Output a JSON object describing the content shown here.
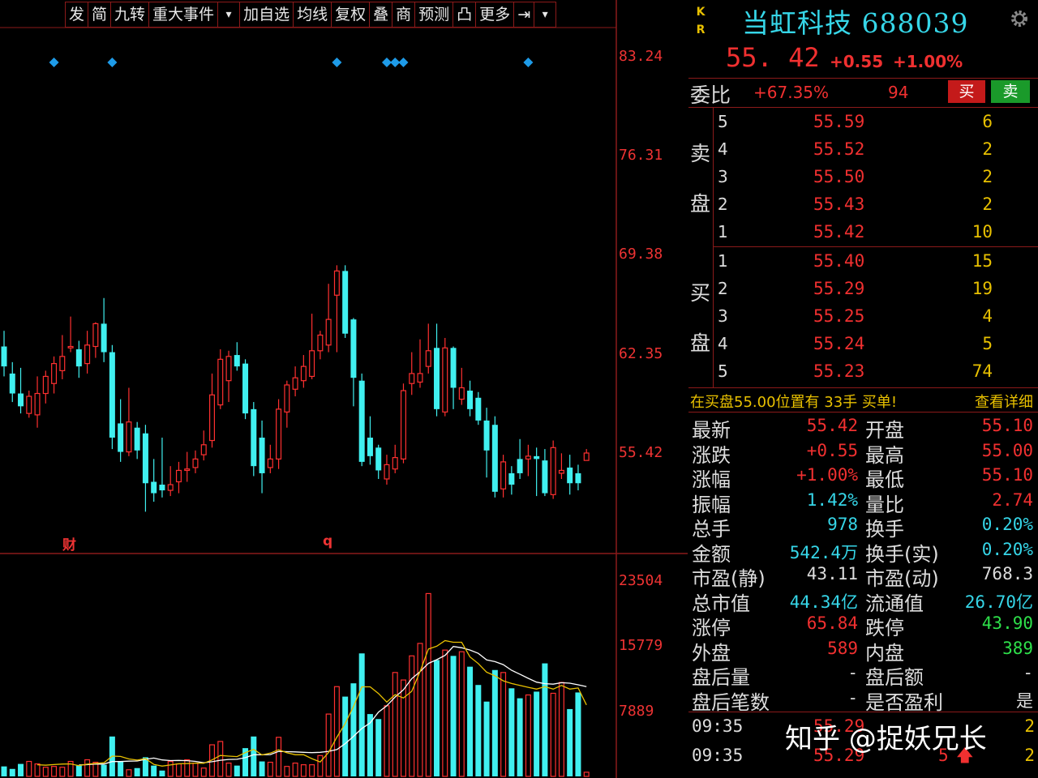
{
  "toolbar": {
    "items": [
      "发",
      "简",
      "九转",
      "重大事件",
      "▾",
      "加自选",
      "均线",
      "复权",
      "叠",
      "商",
      "预测",
      "凸",
      "更多",
      "⇥",
      "▾"
    ]
  },
  "chart": {
    "price_labels": [
      "83.24",
      "76.31",
      "69.38",
      "62.35",
      "55.42"
    ],
    "volume_labels": [
      "23504",
      "15779",
      "7889"
    ],
    "markers": [
      "财",
      "q"
    ],
    "colors": {
      "up": "#ff3030",
      "down": "#40f0f0",
      "ma5": "#e8c000",
      "ma10": "#ffffff",
      "signal": "#1e9be8",
      "grid": "#8b1a1a"
    }
  },
  "chart_data": {
    "type": "candlestick",
    "price_axis": {
      "ylim": [
        51,
        86
      ],
      "ticks": [
        83.24,
        76.31,
        69.38,
        62.35,
        55.42
      ]
    },
    "volume_axis": {
      "ylim": [
        0,
        25500
      ],
      "ticks": [
        23504,
        15779,
        7889
      ]
    },
    "candles": [
      {
        "o": 62.9,
        "c": 61.5,
        "h": 64.0,
        "l": 60.8
      },
      {
        "o": 61.0,
        "c": 59.6,
        "h": 61.8,
        "l": 59.0
      },
      {
        "o": 59.6,
        "c": 58.7,
        "h": 61.4,
        "l": 58.2
      },
      {
        "o": 58.2,
        "c": 59.4,
        "h": 59.8,
        "l": 57.9
      },
      {
        "o": 58.1,
        "c": 59.6,
        "h": 60.8,
        "l": 57.2
      },
      {
        "o": 59.6,
        "c": 60.8,
        "h": 61.2,
        "l": 58.9
      },
      {
        "o": 60.3,
        "c": 61.7,
        "h": 62.2,
        "l": 59.6
      },
      {
        "o": 61.2,
        "c": 62.2,
        "h": 63.7,
        "l": 60.6
      },
      {
        "o": 62.8,
        "c": 62.9,
        "h": 65.0,
        "l": 62.5
      },
      {
        "o": 62.7,
        "c": 61.5,
        "h": 63.3,
        "l": 60.7
      },
      {
        "o": 61.7,
        "c": 63.0,
        "h": 64.0,
        "l": 61.0
      },
      {
        "o": 62.9,
        "c": 64.5,
        "h": 64.6,
        "l": 62.1
      },
      {
        "o": 64.5,
        "c": 62.5,
        "h": 66.3,
        "l": 61.8
      },
      {
        "o": 62.5,
        "c": 56.5,
        "h": 63.0,
        "l": 55.7
      },
      {
        "o": 57.5,
        "c": 55.5,
        "h": 59.2,
        "l": 54.8
      },
      {
        "o": 55.5,
        "c": 57.6,
        "h": 60.0,
        "l": 55.2
      },
      {
        "o": 57.2,
        "c": 55.6,
        "h": 57.6,
        "l": 55.0
      },
      {
        "o": 56.8,
        "c": 53.3,
        "h": 57.4,
        "l": 51.3
      },
      {
        "o": 53.4,
        "c": 52.6,
        "h": 55.0,
        "l": 52.0
      },
      {
        "o": 53.2,
        "c": 52.8,
        "h": 56.5,
        "l": 52.3
      },
      {
        "o": 52.8,
        "c": 53.2,
        "h": 54.5,
        "l": 52.4
      },
      {
        "o": 53.4,
        "c": 54.2,
        "h": 54.8,
        "l": 52.6
      },
      {
        "o": 54.2,
        "c": 54.3,
        "h": 55.5,
        "l": 53.4
      },
      {
        "o": 54.4,
        "c": 55.0,
        "h": 55.6,
        "l": 54.0
      },
      {
        "o": 55.3,
        "c": 56.0,
        "h": 57.0,
        "l": 54.9
      },
      {
        "o": 56.3,
        "c": 59.5,
        "h": 61.0,
        "l": 55.8
      },
      {
        "o": 58.8,
        "c": 62.0,
        "h": 62.7,
        "l": 58.5
      },
      {
        "o": 60.5,
        "c": 62.2,
        "h": 62.6,
        "l": 59.0
      },
      {
        "o": 62.3,
        "c": 61.5,
        "h": 63.2,
        "l": 61.2
      },
      {
        "o": 61.7,
        "c": 58.2,
        "h": 62.0,
        "l": 57.8
      },
      {
        "o": 58.5,
        "c": 54.5,
        "h": 59.0,
        "l": 53.8
      },
      {
        "o": 56.5,
        "c": 54.0,
        "h": 57.7,
        "l": 52.6
      },
      {
        "o": 54.4,
        "c": 55.0,
        "h": 56.0,
        "l": 54.0
      },
      {
        "o": 55.0,
        "c": 58.5,
        "h": 59.2,
        "l": 54.3
      },
      {
        "o": 58.3,
        "c": 60.2,
        "h": 60.5,
        "l": 57.2
      },
      {
        "o": 59.9,
        "c": 60.7,
        "h": 61.5,
        "l": 59.4
      },
      {
        "o": 60.5,
        "c": 61.5,
        "h": 62.3,
        "l": 60.0
      },
      {
        "o": 60.8,
        "c": 62.6,
        "h": 65.2,
        "l": 60.6
      },
      {
        "o": 62.6,
        "c": 63.7,
        "h": 64.0,
        "l": 62.0
      },
      {
        "o": 63.0,
        "c": 64.8,
        "h": 67.3,
        "l": 62.5
      },
      {
        "o": 66.5,
        "c": 68.2,
        "h": 68.6,
        "l": 62.5
      },
      {
        "o": 68.2,
        "c": 63.8,
        "h": 68.6,
        "l": 63.5
      },
      {
        "o": 64.8,
        "c": 60.7,
        "h": 64.9,
        "l": 58.7
      },
      {
        "o": 60.5,
        "c": 54.8,
        "h": 61.0,
        "l": 54.5
      },
      {
        "o": 56.5,
        "c": 55.2,
        "h": 58.0,
        "l": 54.6
      },
      {
        "o": 55.8,
        "c": 54.2,
        "h": 56.0,
        "l": 53.6
      },
      {
        "o": 53.6,
        "c": 54.6,
        "h": 55.3,
        "l": 53.2
      },
      {
        "o": 54.3,
        "c": 55.1,
        "h": 56.0,
        "l": 54.0
      },
      {
        "o": 55.0,
        "c": 59.8,
        "h": 60.3,
        "l": 54.7
      },
      {
        "o": 60.3,
        "c": 61.0,
        "h": 62.5,
        "l": 59.5
      },
      {
        "o": 60.4,
        "c": 61.0,
        "h": 63.4,
        "l": 60.0
      },
      {
        "o": 61.5,
        "c": 62.6,
        "h": 64.5,
        "l": 61.0
      },
      {
        "o": 62.8,
        "c": 58.5,
        "h": 64.5,
        "l": 58.0
      },
      {
        "o": 58.3,
        "c": 62.8,
        "h": 63.5,
        "l": 58.0
      },
      {
        "o": 62.8,
        "c": 60.0,
        "h": 62.9,
        "l": 58.5
      },
      {
        "o": 59.2,
        "c": 60.0,
        "h": 61.4,
        "l": 58.8
      },
      {
        "o": 59.8,
        "c": 58.5,
        "h": 60.5,
        "l": 58.0
      },
      {
        "o": 59.3,
        "c": 57.7,
        "h": 59.7,
        "l": 57.4
      },
      {
        "o": 57.7,
        "c": 55.6,
        "h": 58.6,
        "l": 53.7
      },
      {
        "o": 57.4,
        "c": 52.7,
        "h": 58.0,
        "l": 52.3
      },
      {
        "o": 52.9,
        "c": 54.8,
        "h": 55.3,
        "l": 52.3
      },
      {
        "o": 54.0,
        "c": 53.2,
        "h": 54.5,
        "l": 52.5
      },
      {
        "o": 55.0,
        "c": 54.0,
        "h": 56.4,
        "l": 53.6
      },
      {
        "o": 55.0,
        "c": 55.2,
        "h": 56.0,
        "l": 53.8
      },
      {
        "o": 55.2,
        "c": 55.0,
        "h": 55.8,
        "l": 52.4
      },
      {
        "o": 54.9,
        "c": 52.6,
        "h": 55.7,
        "l": 52.4
      },
      {
        "o": 52.5,
        "c": 55.8,
        "h": 56.3,
        "l": 52.2
      },
      {
        "o": 54.0,
        "c": 54.2,
        "h": 55.4,
        "l": 53.6
      },
      {
        "o": 54.4,
        "c": 53.3,
        "h": 55.3,
        "l": 52.5
      },
      {
        "o": 54.0,
        "c": 53.3,
        "h": 54.6,
        "l": 52.8
      },
      {
        "o": 54.9,
        "c": 55.42,
        "h": 55.7,
        "l": 54.9
      }
    ],
    "volumes": [
      1200,
      900,
      1500,
      1800,
      1500,
      1100,
      1200,
      1100,
      1800,
      1300,
      2000,
      1700,
      1400,
      4800,
      1800,
      800,
      1000,
      2300,
      1300,
      700,
      1800,
      1500,
      2000,
      1600,
      1000,
      3800,
      4200,
      1600,
      1300,
      3400,
      4800,
      1800,
      1700,
      4700,
      1200,
      1600,
      1400,
      1400,
      2500,
      7500,
      10800,
      9600,
      11200,
      14800,
      7500,
      6900,
      8500,
      12500,
      11600,
      14500,
      16000,
      22000,
      14000,
      15200,
      14500,
      15000,
      13200,
      11000,
      9000,
      12800,
      12500,
      10600,
      9400,
      9800,
      10200,
      13600,
      10000,
      11300,
      8100,
      10100,
      500
    ],
    "ma5": [
      null,
      null,
      null,
      null,
      1400,
      1350,
      1420,
      1480,
      1500,
      1300,
      1470,
      1560,
      1640,
      2440,
      2400,
      2100,
      1960,
      2140,
      1440,
      1240,
      1380,
      1520,
      1540,
      1600,
      1580,
      1980,
      2520,
      2440,
      2380,
      2860,
      3260,
      2580,
      2800,
      3200,
      2840,
      2600,
      2600,
      2140,
      1740,
      2880,
      4720,
      6360,
      8420,
      10780,
      10780,
      9980,
      8940,
      9840,
      9440,
      10240,
      12620,
      15320,
      15660,
      16340,
      16140,
      16140,
      14380,
      13580,
      12540,
      12100,
      11500,
      11180,
      10940,
      10720,
      10500,
      10800,
      10500,
      10940,
      10500,
      10640,
      8600
    ],
    "ma10": [
      null,
      null,
      null,
      null,
      null,
      null,
      null,
      null,
      null,
      1380,
      1410,
      1490,
      1480,
      1780,
      1780,
      1830,
      1850,
      2050,
      2200,
      1980,
      1900,
      1920,
      1890,
      1800,
      1640,
      1770,
      1940,
      2040,
      2060,
      2250,
      2600,
      2600,
      2620,
      3000,
      2970,
      2950,
      2900,
      2860,
      2900,
      3010,
      3230,
      3940,
      4820,
      5760,
      6440,
      7730,
      8490,
      9550,
      10430,
      11760,
      12600,
      13600,
      14040,
      14560,
      15630,
      15480,
      15200,
      14800,
      14010,
      13810,
      13450,
      12770,
      12300,
      11800,
      11340,
      11160,
      11100,
      11270,
      11220,
      11020,
      10800
    ],
    "signal_candles": [
      6,
      13,
      40,
      46,
      47,
      48,
      63
    ]
  },
  "stock": {
    "kr": [
      "K",
      "R"
    ],
    "title": "当虹科技 688039",
    "last_price": "55. 42",
    "change_abs": "+0.55",
    "change_pct": "+1.00%"
  },
  "weibi": {
    "label": "委比",
    "value": "+67.35%",
    "diff": "94",
    "buy_label": "买",
    "sell_label": "卖"
  },
  "order_book": {
    "sell_label": [
      "卖",
      "盘"
    ],
    "buy_label": [
      "买",
      "盘"
    ],
    "sell": [
      {
        "level": "5",
        "price": "55.59",
        "vol": "6"
      },
      {
        "level": "4",
        "price": "55.52",
        "vol": "2"
      },
      {
        "level": "3",
        "price": "55.50",
        "vol": "2"
      },
      {
        "level": "2",
        "price": "55.43",
        "vol": "2"
      },
      {
        "level": "1",
        "price": "55.42",
        "vol": "10"
      }
    ],
    "buy": [
      {
        "level": "1",
        "price": "55.40",
        "vol": "15"
      },
      {
        "level": "2",
        "price": "55.29",
        "vol": "19"
      },
      {
        "level": "3",
        "price": "55.25",
        "vol": "4"
      },
      {
        "level": "4",
        "price": "55.24",
        "vol": "5"
      },
      {
        "level": "5",
        "price": "55.23",
        "vol": "74"
      }
    ]
  },
  "notice": {
    "text": "在买盘55.00位置有 33手 买单!",
    "link": "查看详细"
  },
  "stats": [
    {
      "l1": "最新",
      "v1": "55.42",
      "c1": "red",
      "l2": "开盘",
      "v2": "55.10",
      "c2": "red"
    },
    {
      "l1": "涨跌",
      "v1": "+0.55",
      "c1": "red",
      "l2": "最高",
      "v2": "55.00",
      "c2": "red"
    },
    {
      "l1": "涨幅",
      "v1": "+1.00%",
      "c1": "red",
      "l2": "最低",
      "v2": "55.10",
      "c2": "red"
    },
    {
      "l1": "振幅",
      "v1": "1.42%",
      "c1": "cyan",
      "l2": "量比",
      "v2": "2.74",
      "c2": "red"
    },
    {
      "l1": "总手",
      "v1": "978",
      "c1": "cyan",
      "l2": "换手",
      "v2": "0.20%",
      "c2": "cyan"
    },
    {
      "l1": "金额",
      "v1": "542.4万",
      "c1": "cyan",
      "l2": "换手(实)",
      "v2": "0.20%",
      "c2": "cyan"
    },
    {
      "l1": "市盈(静)",
      "v1": "43.11",
      "c1": "white",
      "l2": "市盈(动)",
      "v2": "768.3",
      "c2": "white"
    },
    {
      "l1": "总市值",
      "v1": "44.34亿",
      "c1": "cyan",
      "l2": "流通值",
      "v2": "26.70亿",
      "c2": "cyan"
    },
    {
      "l1": "涨停",
      "v1": "65.84",
      "c1": "red",
      "l2": "跌停",
      "v2": "43.90",
      "c2": "green"
    },
    {
      "l1": "外盘",
      "v1": "589",
      "c1": "red",
      "l2": "内盘",
      "v2": "389",
      "c2": "green"
    },
    {
      "l1": "盘后量",
      "v1": "-",
      "c1": "white",
      "l2": "盘后额",
      "v2": "-",
      "c2": "white"
    },
    {
      "l1": "盘后笔数",
      "v1": "-",
      "c1": "white",
      "l2": "是否盈利",
      "v2": "是",
      "c2": "white"
    }
  ],
  "ticks": [
    {
      "time": "09:35",
      "price": "55.29",
      "vol": "",
      "arrow": "",
      "count": "2"
    },
    {
      "time": "09:35",
      "price": "55.29",
      "vol": "5",
      "arrow": "🡅",
      "count": "2"
    }
  ],
  "watermark": "知乎 @捉妖兄长"
}
